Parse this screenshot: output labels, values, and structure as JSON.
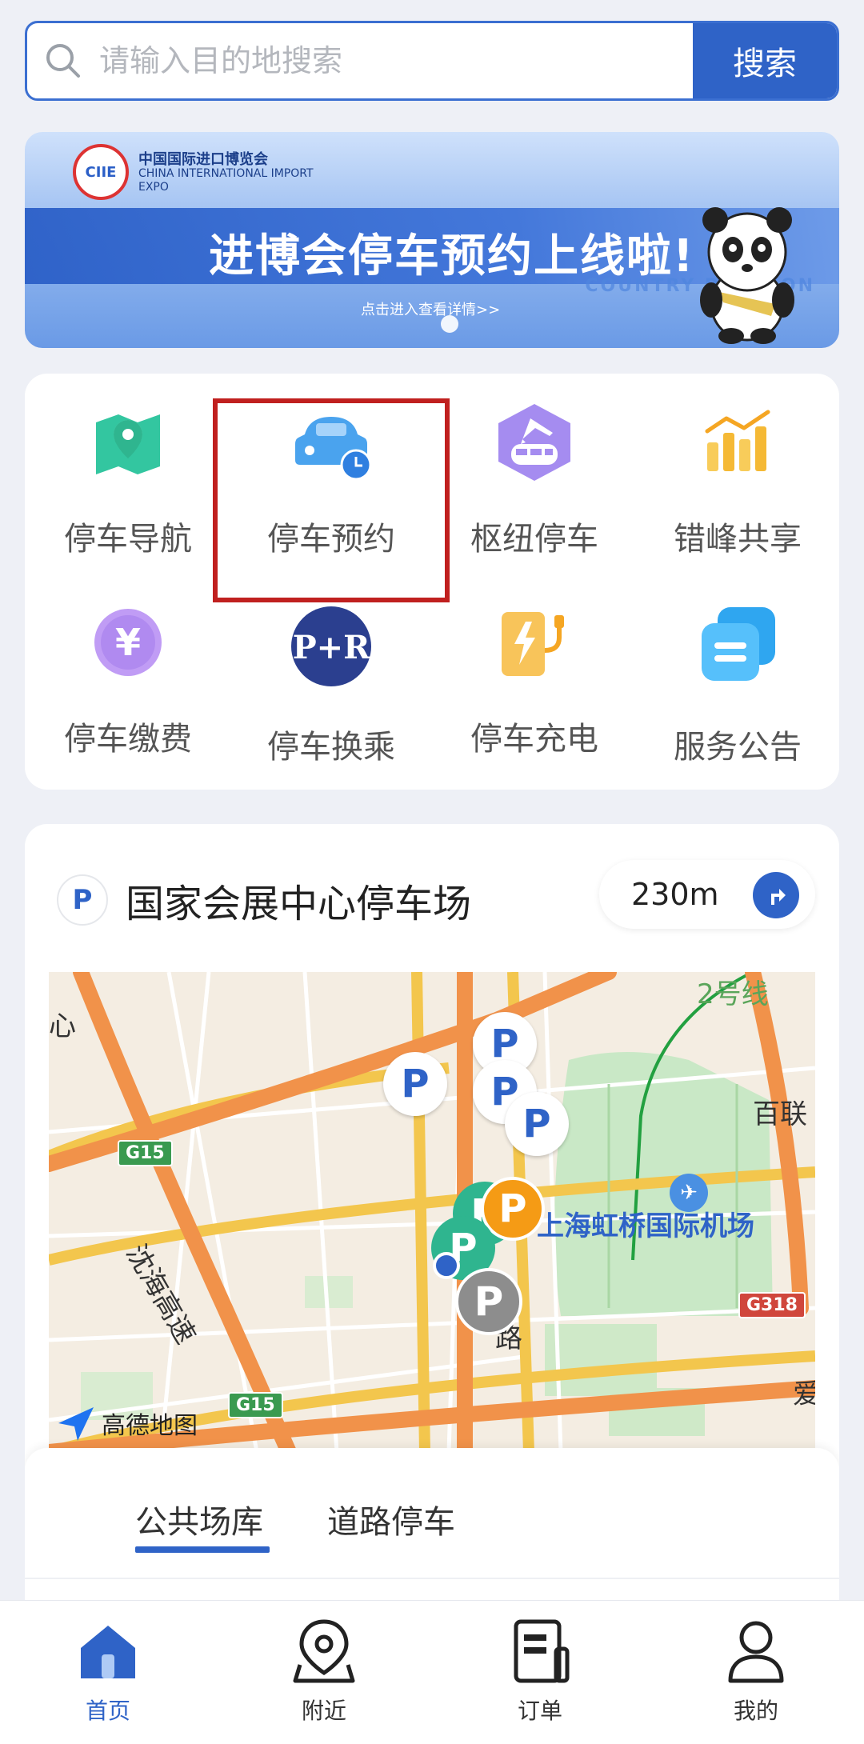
{
  "search": {
    "placeholder": "请输入目的地搜索",
    "button": "搜索"
  },
  "banner": {
    "expo_cn": "中国国际进口博览会",
    "expo_en": "CHINA INTERNATIONAL IMPORT EXPO",
    "title": "进博会停车预约上线啦!",
    "subtitle": "点击进入查看详情>>",
    "country_pavilion": "COUNTRY PAVILION"
  },
  "services": [
    {
      "label": "停车导航",
      "icon": "map-location-icon"
    },
    {
      "label": "停车预约",
      "icon": "car-clock-icon"
    },
    {
      "label": "枢纽停车",
      "icon": "train-plane-icon"
    },
    {
      "label": "错峰共享",
      "icon": "bar-chart-icon"
    },
    {
      "label": "停车缴费",
      "icon": "yuan-coin-icon"
    },
    {
      "label": "停车换乘",
      "icon": "park-and-ride-icon"
    },
    {
      "label": "停车充电",
      "icon": "charging-station-icon"
    },
    {
      "label": "服务公告",
      "icon": "notice-icon"
    }
  ],
  "parking": {
    "p_symbol": "P",
    "name": "国家会展中心停车场",
    "distance": "230m"
  },
  "map": {
    "labels": [
      "2号线",
      "百联",
      "G15",
      "沈海高速",
      "上海虹桥国际机场",
      "G318",
      "G15",
      "爱",
      "心",
      "路"
    ],
    "logo": "高德地图"
  },
  "tabs": [
    "公共场库",
    "道路停车"
  ],
  "bottom_nav": [
    {
      "label": "首页",
      "icon": "home-icon",
      "active": true
    },
    {
      "label": "附近",
      "icon": "location-pin-icon",
      "active": false
    },
    {
      "label": "订单",
      "icon": "order-document-icon",
      "active": false
    },
    {
      "label": "我的",
      "icon": "user-icon",
      "active": false
    }
  ],
  "colors": {
    "primary": "#2f63c7",
    "highlight": "#c0201f",
    "background": "#eef0f6"
  }
}
